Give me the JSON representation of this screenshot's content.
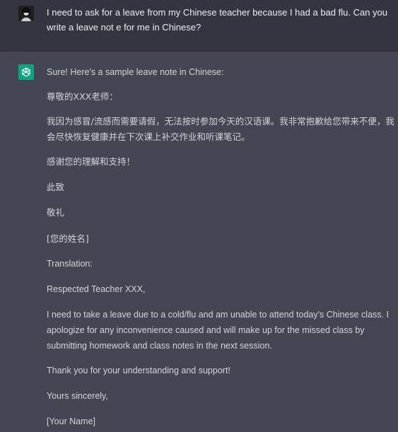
{
  "user_message": {
    "text": "I need to ask for a leave from my Chinese teacher because I had a bad flu. Can you write a leave not e for me in Chinese?"
  },
  "assistant_message": {
    "paragraphs": [
      "Sure! Here's a sample leave note in Chinese:",
      "尊敬的XXX老师：",
      "我因为感冒/流感而需要请假，无法按时参加今天的汉语课。我非常抱歉给您带来不便，我会尽快恢复健康并在下次课上补交作业和听课笔记。",
      "感谢您的理解和支持！",
      "此致",
      "敬礼",
      "[您的姓名]",
      "Translation:",
      "Respected Teacher XXX,",
      "I need to take a leave due to a cold/flu and am unable to attend today's Chinese class. I apologize for any inconvenience caused and will make up for the missed class by submitting homework and class notes in the next session.",
      "Thank you for your understanding and support!",
      "Yours sincerely,",
      "[Your Name]"
    ]
  },
  "icons": {
    "user_avatar": "user-avatar-icon",
    "assistant_avatar": "openai-logo-icon"
  },
  "colors": {
    "user_row_bg": "#343541",
    "assistant_row_bg": "#444654",
    "assistant_avatar_bg": "#10a37f",
    "text_primary": "#ececf1",
    "text_secondary": "#d1d5db"
  }
}
